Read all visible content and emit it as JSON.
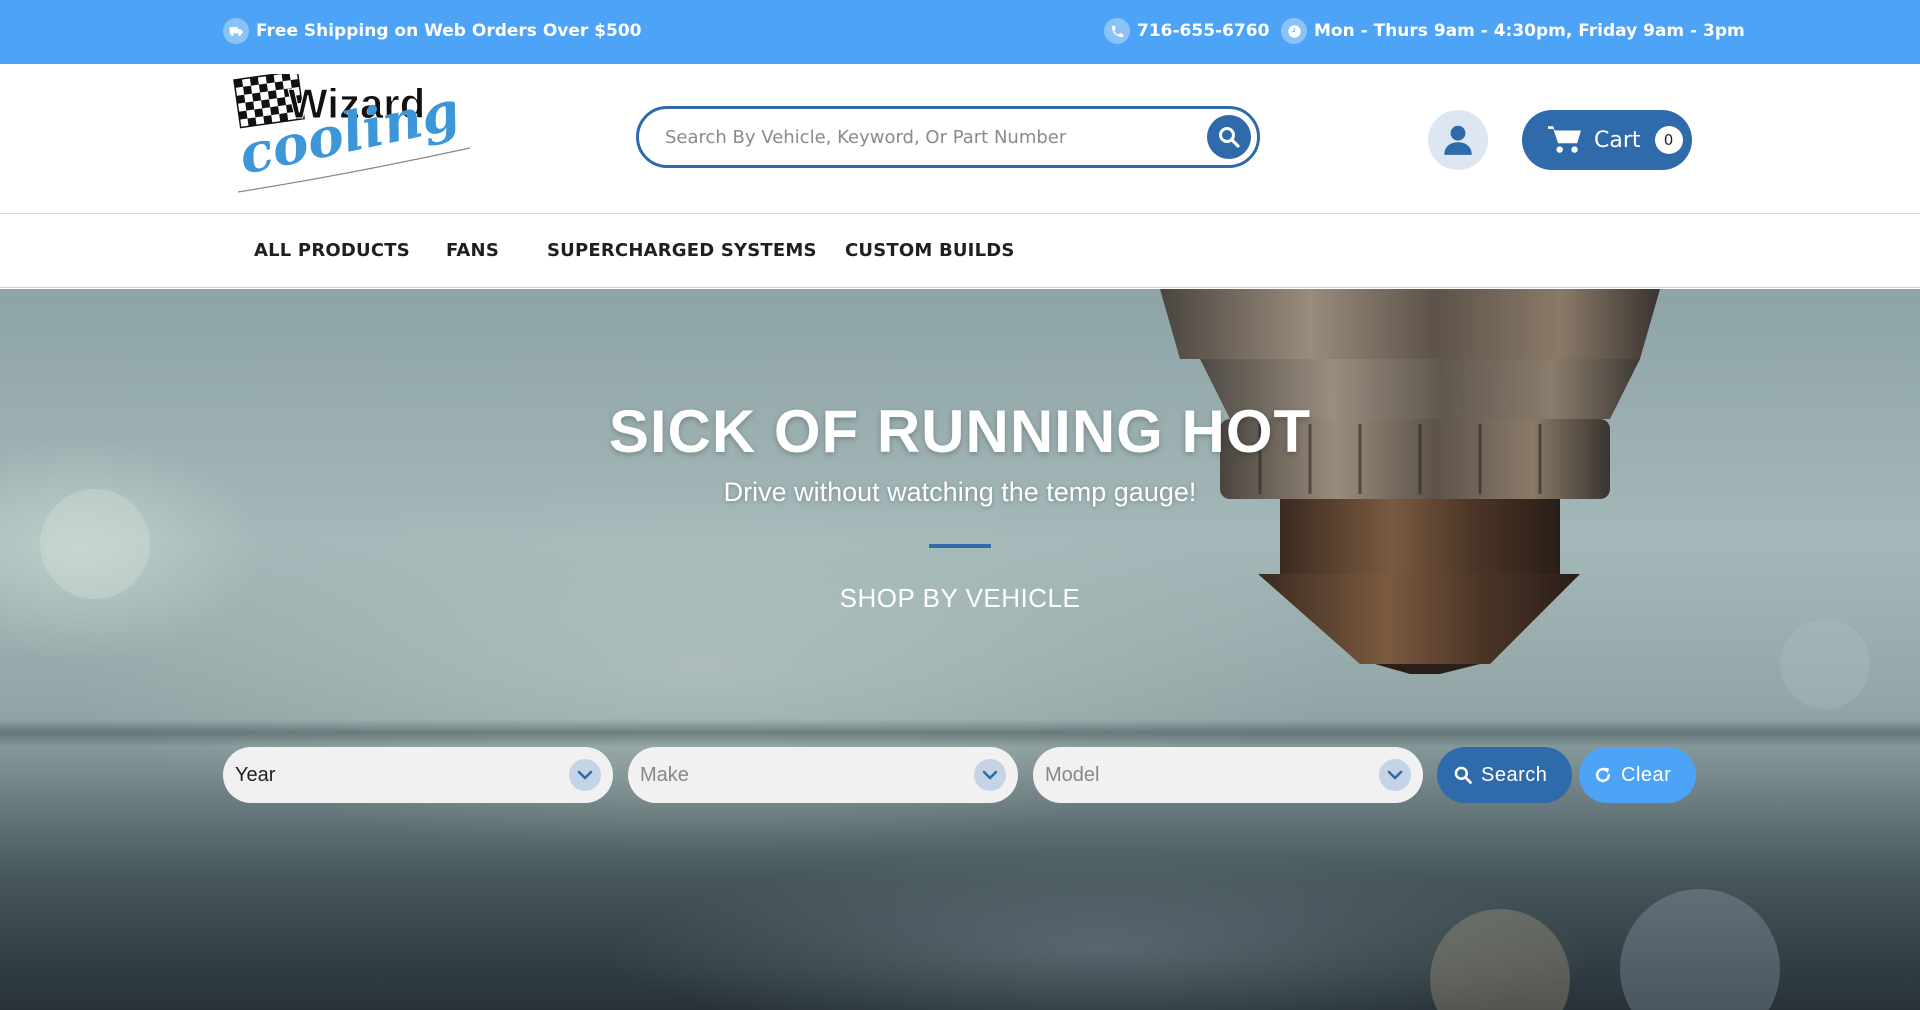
{
  "topbar": {
    "shipping": "Free Shipping on Web Orders Over $500",
    "phone": "716-655-6760",
    "hours": "Mon - Thurs 9am - 4:30pm, Friday 9am - 3pm"
  },
  "header": {
    "logo_text": "Wizard cooling",
    "search_placeholder": "Search By Vehicle, Keyword, Or Part Number",
    "cart_label": "Cart",
    "cart_count": "0"
  },
  "nav": {
    "items": [
      "ALL PRODUCTS",
      "FANS",
      "SUPERCHARGED SYSTEMS",
      "CUSTOM BUILDS"
    ]
  },
  "hero": {
    "title": "SICK OF RUNNING HOT",
    "subtitle": "Drive without watching the temp gauge!",
    "shop_by": "SHOP BY VEHICLE",
    "year": "Year",
    "make": "Make",
    "model": "Model",
    "search_label": "Search",
    "clear_label": "Clear"
  },
  "colors": {
    "topbar": "#4da3f5",
    "primary": "#2f6aaa",
    "light_button": "#4da3f5"
  },
  "icons": [
    "truck-icon",
    "phone-icon",
    "clock-icon",
    "search-icon",
    "user-icon",
    "cart-icon",
    "chevron-down-icon",
    "refresh-icon"
  ]
}
